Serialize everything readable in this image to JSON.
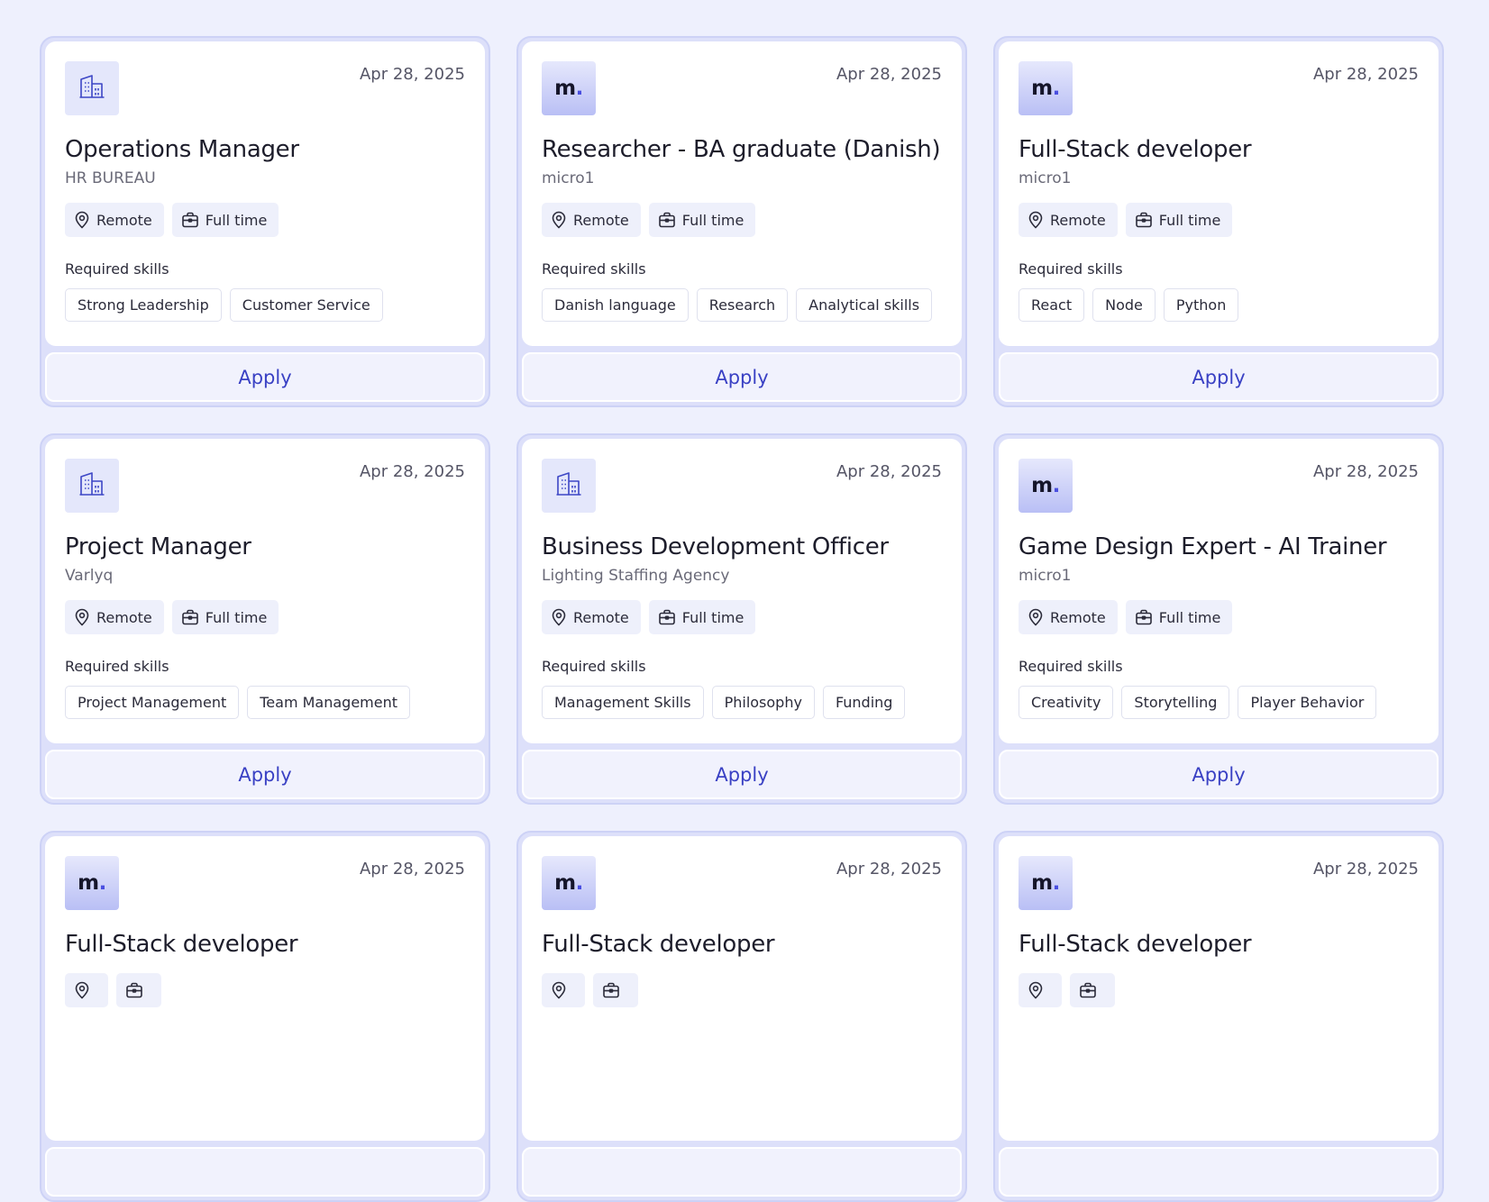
{
  "colors": {
    "page_background": "#eef0fd",
    "accent": "#3a41c4",
    "card_border": "#cdd2f6"
  },
  "jobs": [
    {
      "logo": "building-icon",
      "date": "Apr 28, 2025",
      "title": "Operations Manager",
      "company": "HR BUREAU",
      "location": "Remote",
      "job_type": "Full time",
      "skills_label": "Required skills",
      "skills": [
        "Strong Leadership",
        "Customer Service"
      ],
      "apply_label": "Apply"
    },
    {
      "logo": "micro1-logo",
      "date": "Apr 28, 2025",
      "title": "Researcher - BA graduate (Danish)",
      "company": "micro1",
      "location": "Remote",
      "job_type": "Full time",
      "skills_label": "Required skills",
      "skills": [
        "Danish language",
        "Research",
        "Analytical skills"
      ],
      "apply_label": "Apply"
    },
    {
      "logo": "micro1-logo",
      "date": "Apr 28, 2025",
      "title": "Full-Stack developer",
      "company": "micro1",
      "location": "Remote",
      "job_type": "Full time",
      "skills_label": "Required skills",
      "skills": [
        "React",
        "Node",
        "Python"
      ],
      "apply_label": "Apply"
    },
    {
      "logo": "building-icon",
      "date": "Apr 28, 2025",
      "title": "Project Manager",
      "company": "Varlyq",
      "location": "Remote",
      "job_type": "Full time",
      "skills_label": "Required skills",
      "skills": [
        "Project Management",
        "Team Management"
      ],
      "apply_label": "Apply"
    },
    {
      "logo": "building-icon",
      "date": "Apr 28, 2025",
      "title": "Business Development Officer",
      "company": "Lighting Staffing Agency",
      "location": "Remote",
      "job_type": "Full time",
      "skills_label": "Required skills",
      "skills": [
        "Management Skills",
        "Philosophy",
        "Funding"
      ],
      "apply_label": "Apply"
    },
    {
      "logo": "micro1-logo",
      "date": "Apr 28, 2025",
      "title": "Game Design Expert - AI Trainer",
      "company": "micro1",
      "location": "Remote",
      "job_type": "Full time",
      "skills_label": "Required skills",
      "skills": [
        "Creativity",
        "Storytelling",
        "Player Behavior"
      ],
      "apply_label": "Apply"
    },
    {
      "logo": "micro1-logo",
      "date": "Apr 28, 2025",
      "title": "Full-Stack developer",
      "company": "",
      "location": "",
      "job_type": "",
      "skills_label": "",
      "skills": [],
      "apply_label": ""
    },
    {
      "logo": "micro1-logo",
      "date": "Apr 28, 2025",
      "title": "Full-Stack developer",
      "company": "",
      "location": "",
      "job_type": "",
      "skills_label": "",
      "skills": [],
      "apply_label": ""
    },
    {
      "logo": "micro1-logo",
      "date": "Apr 28, 2025",
      "title": "Full-Stack developer",
      "company": "",
      "location": "",
      "job_type": "",
      "skills_label": "",
      "skills": [],
      "apply_label": ""
    }
  ],
  "logo_text": {
    "letter": "m",
    "dot": "."
  }
}
